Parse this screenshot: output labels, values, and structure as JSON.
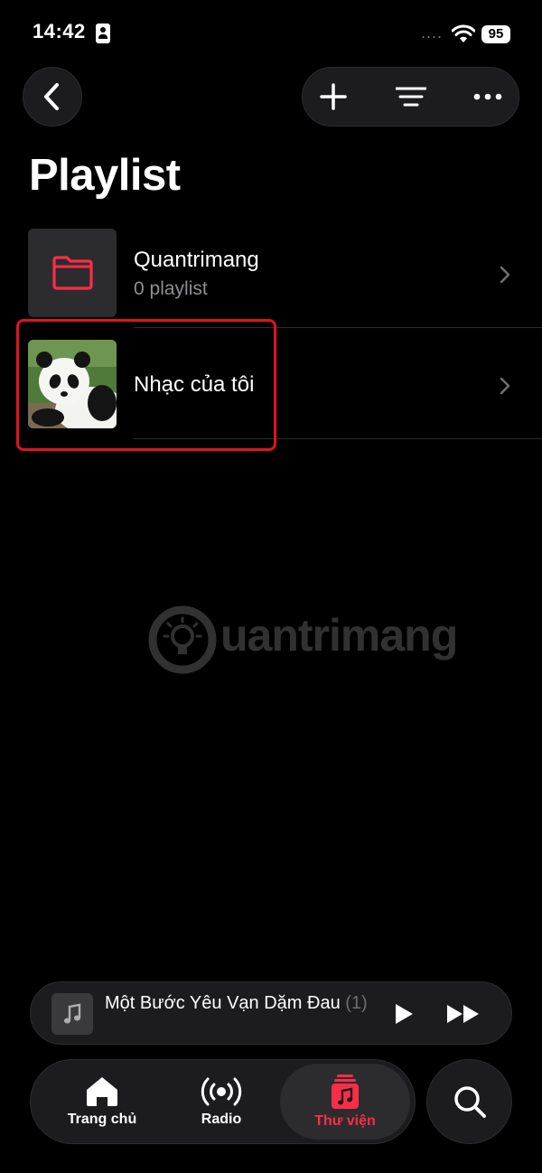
{
  "status_bar": {
    "time": "14:42",
    "signal_dots": "....",
    "battery": "95"
  },
  "header": {
    "title": "Playlist"
  },
  "playlists": [
    {
      "title": "Quantrimang",
      "subtitle": "0 playlist",
      "artwork": "folder-icon"
    },
    {
      "title": "Nhạc của tôi",
      "artwork": "panda-photo"
    }
  ],
  "watermark": {
    "text": "uantrimang"
  },
  "mini_player": {
    "title": "Một Bước Yêu Vạn Dặm Đau",
    "count": "(1)"
  },
  "tabs": [
    {
      "label": "Trang chủ",
      "icon": "home-icon"
    },
    {
      "label": "Radio",
      "icon": "radio-icon"
    },
    {
      "label": "Thư viện",
      "icon": "library-icon",
      "active": true
    }
  ],
  "colors": {
    "accent": "#fa2d48",
    "highlight_box": "#e0141e",
    "background": "#000000"
  }
}
